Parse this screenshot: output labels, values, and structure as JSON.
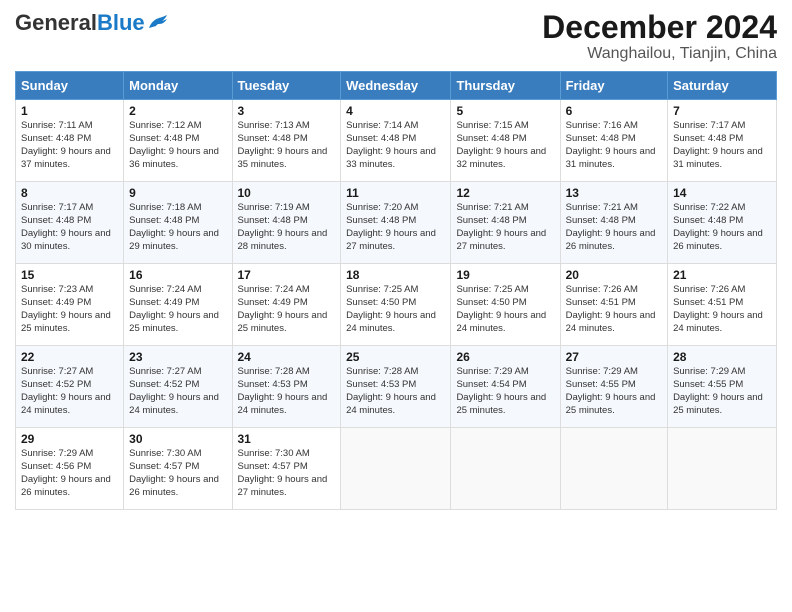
{
  "header": {
    "logo_general": "General",
    "logo_blue": "Blue",
    "month_title": "December 2024",
    "location": "Wanghailou, Tianjin, China"
  },
  "weekdays": [
    "Sunday",
    "Monday",
    "Tuesday",
    "Wednesday",
    "Thursday",
    "Friday",
    "Saturday"
  ],
  "weeks": [
    [
      {
        "day": "1",
        "sunrise": "Sunrise: 7:11 AM",
        "sunset": "Sunset: 4:48 PM",
        "daylight": "Daylight: 9 hours and 37 minutes."
      },
      {
        "day": "2",
        "sunrise": "Sunrise: 7:12 AM",
        "sunset": "Sunset: 4:48 PM",
        "daylight": "Daylight: 9 hours and 36 minutes."
      },
      {
        "day": "3",
        "sunrise": "Sunrise: 7:13 AM",
        "sunset": "Sunset: 4:48 PM",
        "daylight": "Daylight: 9 hours and 35 minutes."
      },
      {
        "day": "4",
        "sunrise": "Sunrise: 7:14 AM",
        "sunset": "Sunset: 4:48 PM",
        "daylight": "Daylight: 9 hours and 33 minutes."
      },
      {
        "day": "5",
        "sunrise": "Sunrise: 7:15 AM",
        "sunset": "Sunset: 4:48 PM",
        "daylight": "Daylight: 9 hours and 32 minutes."
      },
      {
        "day": "6",
        "sunrise": "Sunrise: 7:16 AM",
        "sunset": "Sunset: 4:48 PM",
        "daylight": "Daylight: 9 hours and 31 minutes."
      },
      {
        "day": "7",
        "sunrise": "Sunrise: 7:17 AM",
        "sunset": "Sunset: 4:48 PM",
        "daylight": "Daylight: 9 hours and 31 minutes."
      }
    ],
    [
      {
        "day": "8",
        "sunrise": "Sunrise: 7:17 AM",
        "sunset": "Sunset: 4:48 PM",
        "daylight": "Daylight: 9 hours and 30 minutes."
      },
      {
        "day": "9",
        "sunrise": "Sunrise: 7:18 AM",
        "sunset": "Sunset: 4:48 PM",
        "daylight": "Daylight: 9 hours and 29 minutes."
      },
      {
        "day": "10",
        "sunrise": "Sunrise: 7:19 AM",
        "sunset": "Sunset: 4:48 PM",
        "daylight": "Daylight: 9 hours and 28 minutes."
      },
      {
        "day": "11",
        "sunrise": "Sunrise: 7:20 AM",
        "sunset": "Sunset: 4:48 PM",
        "daylight": "Daylight: 9 hours and 27 minutes."
      },
      {
        "day": "12",
        "sunrise": "Sunrise: 7:21 AM",
        "sunset": "Sunset: 4:48 PM",
        "daylight": "Daylight: 9 hours and 27 minutes."
      },
      {
        "day": "13",
        "sunrise": "Sunrise: 7:21 AM",
        "sunset": "Sunset: 4:48 PM",
        "daylight": "Daylight: 9 hours and 26 minutes."
      },
      {
        "day": "14",
        "sunrise": "Sunrise: 7:22 AM",
        "sunset": "Sunset: 4:48 PM",
        "daylight": "Daylight: 9 hours and 26 minutes."
      }
    ],
    [
      {
        "day": "15",
        "sunrise": "Sunrise: 7:23 AM",
        "sunset": "Sunset: 4:49 PM",
        "daylight": "Daylight: 9 hours and 25 minutes."
      },
      {
        "day": "16",
        "sunrise": "Sunrise: 7:24 AM",
        "sunset": "Sunset: 4:49 PM",
        "daylight": "Daylight: 9 hours and 25 minutes."
      },
      {
        "day": "17",
        "sunrise": "Sunrise: 7:24 AM",
        "sunset": "Sunset: 4:49 PM",
        "daylight": "Daylight: 9 hours and 25 minutes."
      },
      {
        "day": "18",
        "sunrise": "Sunrise: 7:25 AM",
        "sunset": "Sunset: 4:50 PM",
        "daylight": "Daylight: 9 hours and 24 minutes."
      },
      {
        "day": "19",
        "sunrise": "Sunrise: 7:25 AM",
        "sunset": "Sunset: 4:50 PM",
        "daylight": "Daylight: 9 hours and 24 minutes."
      },
      {
        "day": "20",
        "sunrise": "Sunrise: 7:26 AM",
        "sunset": "Sunset: 4:51 PM",
        "daylight": "Daylight: 9 hours and 24 minutes."
      },
      {
        "day": "21",
        "sunrise": "Sunrise: 7:26 AM",
        "sunset": "Sunset: 4:51 PM",
        "daylight": "Daylight: 9 hours and 24 minutes."
      }
    ],
    [
      {
        "day": "22",
        "sunrise": "Sunrise: 7:27 AM",
        "sunset": "Sunset: 4:52 PM",
        "daylight": "Daylight: 9 hours and 24 minutes."
      },
      {
        "day": "23",
        "sunrise": "Sunrise: 7:27 AM",
        "sunset": "Sunset: 4:52 PM",
        "daylight": "Daylight: 9 hours and 24 minutes."
      },
      {
        "day": "24",
        "sunrise": "Sunrise: 7:28 AM",
        "sunset": "Sunset: 4:53 PM",
        "daylight": "Daylight: 9 hours and 24 minutes."
      },
      {
        "day": "25",
        "sunrise": "Sunrise: 7:28 AM",
        "sunset": "Sunset: 4:53 PM",
        "daylight": "Daylight: 9 hours and 24 minutes."
      },
      {
        "day": "26",
        "sunrise": "Sunrise: 7:29 AM",
        "sunset": "Sunset: 4:54 PM",
        "daylight": "Daylight: 9 hours and 25 minutes."
      },
      {
        "day": "27",
        "sunrise": "Sunrise: 7:29 AM",
        "sunset": "Sunset: 4:55 PM",
        "daylight": "Daylight: 9 hours and 25 minutes."
      },
      {
        "day": "28",
        "sunrise": "Sunrise: 7:29 AM",
        "sunset": "Sunset: 4:55 PM",
        "daylight": "Daylight: 9 hours and 25 minutes."
      }
    ],
    [
      {
        "day": "29",
        "sunrise": "Sunrise: 7:29 AM",
        "sunset": "Sunset: 4:56 PM",
        "daylight": "Daylight: 9 hours and 26 minutes."
      },
      {
        "day": "30",
        "sunrise": "Sunrise: 7:30 AM",
        "sunset": "Sunset: 4:57 PM",
        "daylight": "Daylight: 9 hours and 26 minutes."
      },
      {
        "day": "31",
        "sunrise": "Sunrise: 7:30 AM",
        "sunset": "Sunset: 4:57 PM",
        "daylight": "Daylight: 9 hours and 27 minutes."
      },
      null,
      null,
      null,
      null
    ]
  ]
}
